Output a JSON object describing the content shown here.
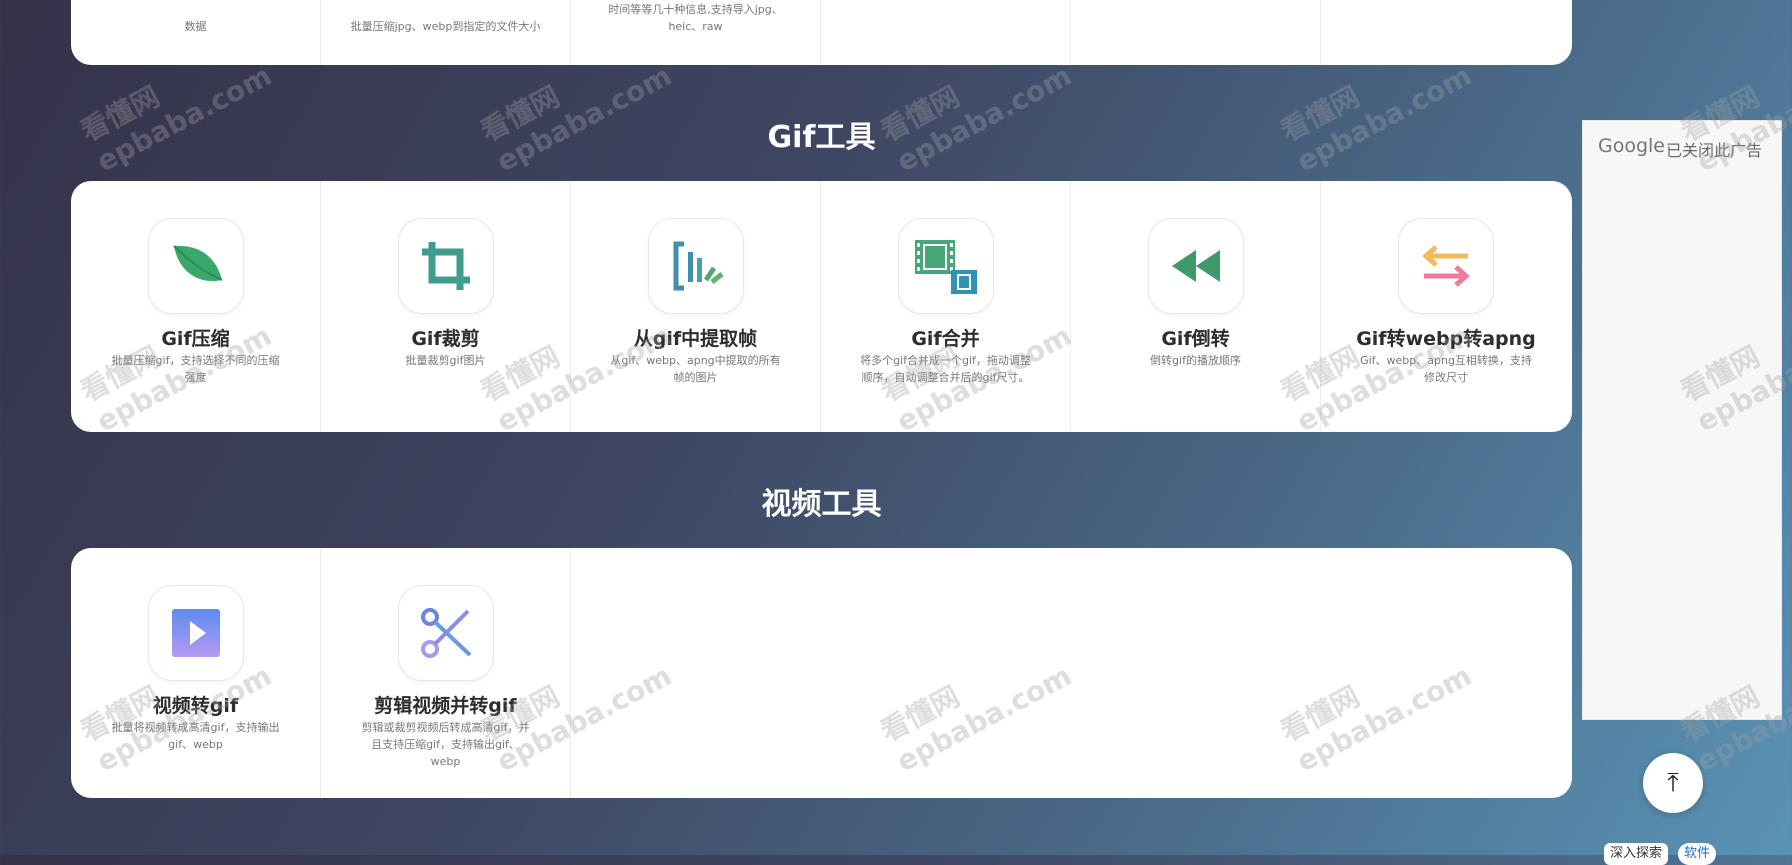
{
  "top_row": {
    "cells": [
      {
        "desc": "数据"
      },
      {
        "desc": "批量压缩jpg、webp到指定的文件大小"
      },
      {
        "desc": "时间等等几十种信息,支持导入jpg、heic、raw"
      },
      {
        "desc": ""
      },
      {
        "desc": ""
      }
    ]
  },
  "gif_section": {
    "title": "Gif工具",
    "tools": [
      {
        "title": "Gif压缩",
        "desc": "批量压缩gif，支持选择不同的压缩强度",
        "icon": "leaf-icon"
      },
      {
        "title": "Gif裁剪",
        "desc": "批量裁剪gif图片",
        "icon": "crop-icon"
      },
      {
        "title": "从gif中提取帧",
        "desc": "从gif、webp、apng中提取的所有帧的图片",
        "icon": "frames-extract-icon"
      },
      {
        "title": "Gif合并",
        "desc": "将多个gif合并成一个gif，拖动调整顺序，自动调整合并后的gif尺寸。",
        "icon": "film-merge-icon"
      },
      {
        "title": "Gif倒转",
        "desc": "倒转gif的播放顺序",
        "icon": "rewind-icon"
      },
      {
        "title": "Gif转webp转apng",
        "desc": "Gif、webp、apng互相转换，支持修改尺寸",
        "icon": "swap-arrows-icon"
      }
    ]
  },
  "video_section": {
    "title": "视频工具",
    "tools": [
      {
        "title": "视频转gif",
        "desc": "批量将视频转成高清gif，支持输出gif、webp",
        "icon": "play-icon"
      },
      {
        "title": "剪辑视频并转gif",
        "desc": "剪辑或裁剪视频后转成高清gif，并且支持压缩gif，支持输出gif、webp",
        "icon": "scissors-icon"
      }
    ]
  },
  "ad": {
    "google": "Google",
    "closed_text": "已关闭此广告"
  },
  "back_to_top": {
    "icon": "arrow-to-top-icon",
    "label": "⤒"
  },
  "badges": [
    "深入探索",
    "软件"
  ],
  "watermark": {
    "line1": "看懂网",
    "line2": "epbaba.com"
  },
  "colors": {
    "leaf": "#3aa86b",
    "crop": "#3f9c8e",
    "rewind": "#3e9a6a",
    "swap_top": "#f4b95a",
    "swap_bottom": "#f07a9a",
    "play": "#7a8df0",
    "scissors": "#8a8ee8"
  }
}
